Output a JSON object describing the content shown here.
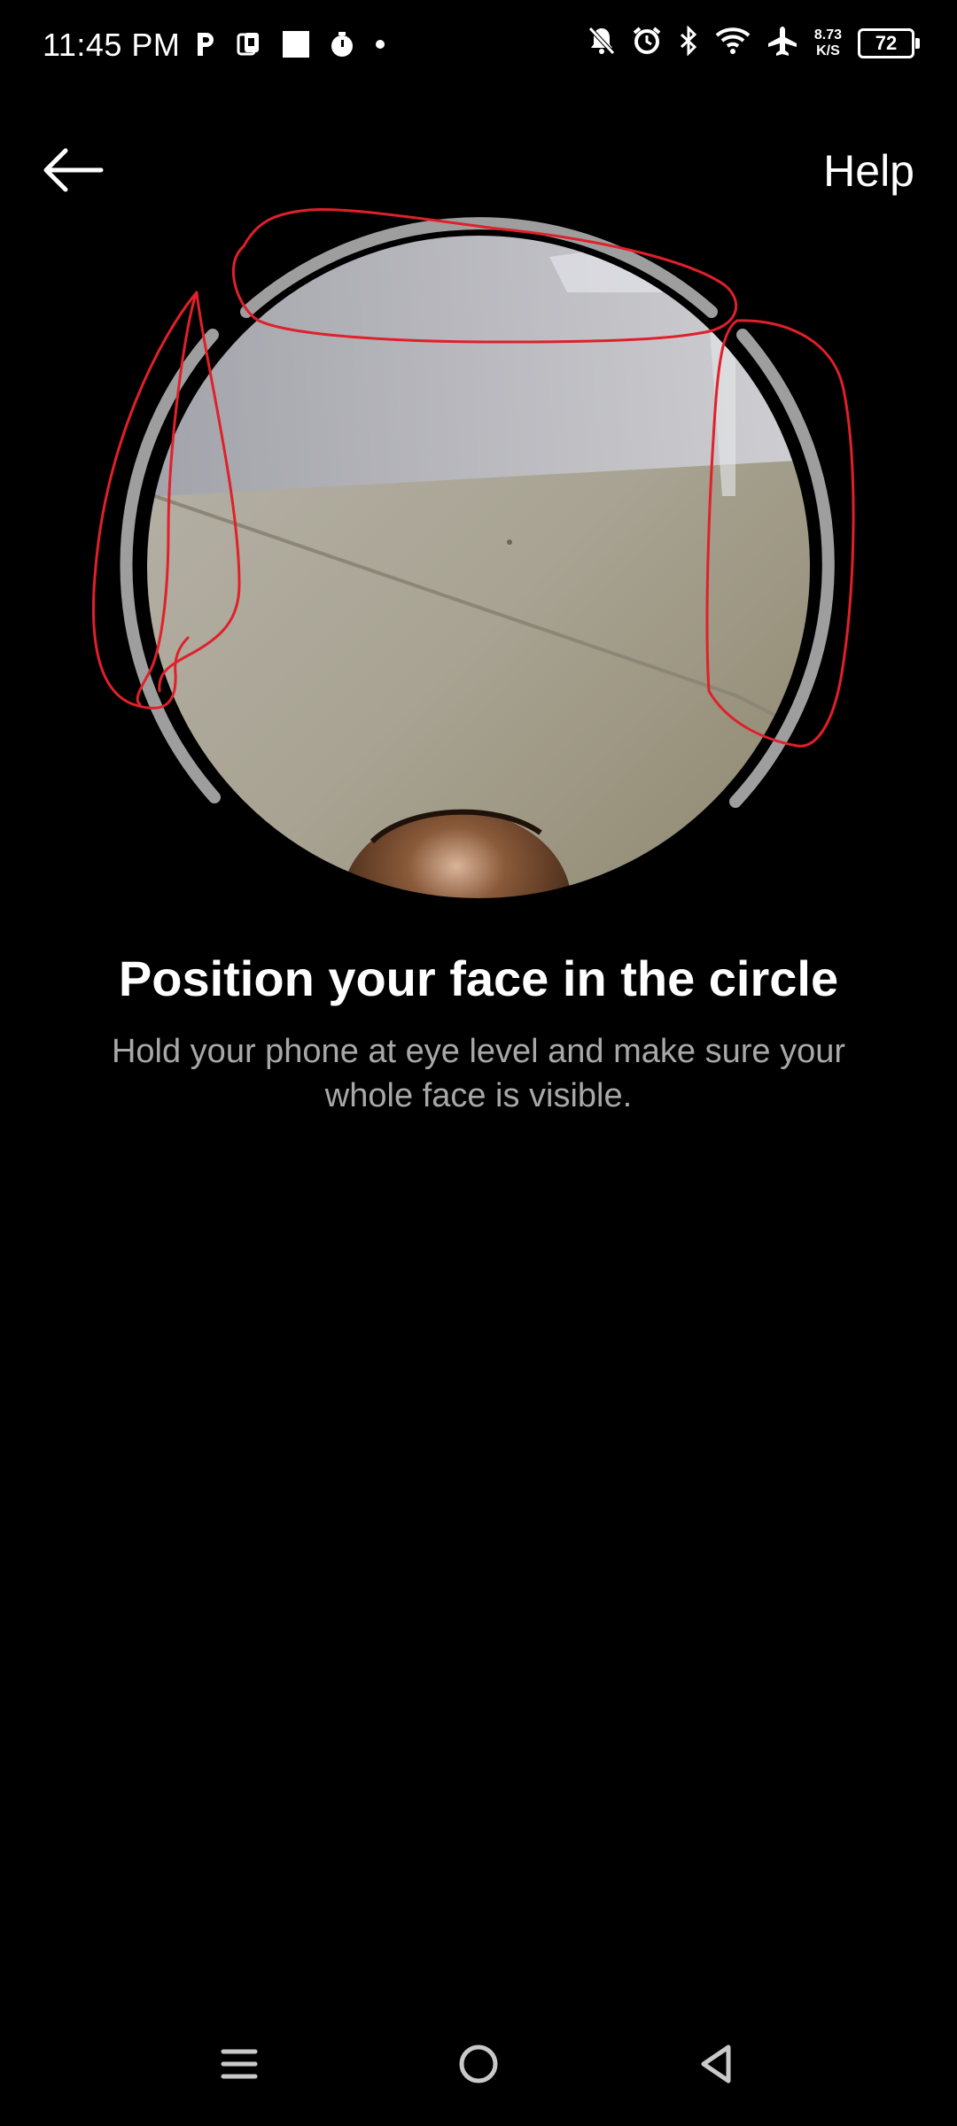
{
  "status_bar": {
    "time": "11:45 PM",
    "left_icons": [
      "parking-icon",
      "sim-icon",
      "square-icon",
      "timer-icon",
      "dot-icon"
    ],
    "right_icons": [
      "bell-muted-icon",
      "alarm-icon",
      "bluetooth-icon",
      "wifi-icon",
      "airplane-icon"
    ],
    "speed_value": "8.73",
    "speed_unit": "K/S",
    "battery": "72"
  },
  "header": {
    "back_icon": "arrow-left-icon",
    "help_label": "Help"
  },
  "camera": {
    "ring_color": "#9e9e9e",
    "annotation_color": "#e0202a"
  },
  "main": {
    "title": "Position your face in the circle",
    "subtitle": "Hold your phone at eye level and make sure your whole face is visible."
  },
  "nav_bar": {
    "icons": [
      "menu-icon",
      "home-icon",
      "back-triangle-icon"
    ]
  }
}
